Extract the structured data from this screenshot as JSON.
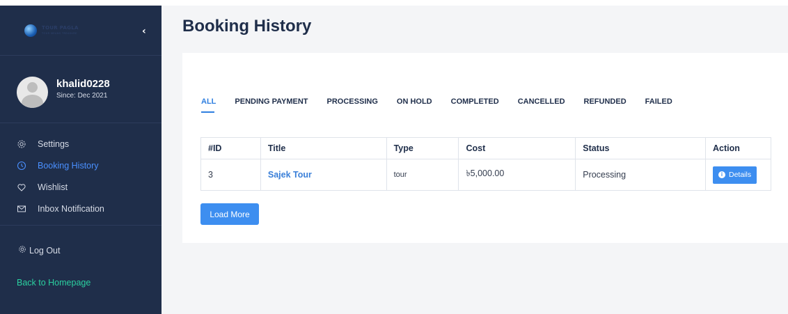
{
  "brand": {
    "logo_name": "TOUR PAGLA",
    "logo_tagline": "TOUR MEANS TREASURE"
  },
  "profile": {
    "username": "khalid0228",
    "since": "Since: Dec 2021"
  },
  "sidebar": {
    "items": [
      {
        "label": "Settings",
        "icon": "gear-icon",
        "active": false
      },
      {
        "label": "Booking History",
        "icon": "clock-icon",
        "active": true
      },
      {
        "label": "Wishlist",
        "icon": "heart-icon",
        "active": false
      },
      {
        "label": "Inbox Notification",
        "icon": "mail-icon",
        "active": false
      }
    ],
    "logout_label": "Log Out",
    "back_home_label": "Back to Homepage"
  },
  "page": {
    "title": "Booking History"
  },
  "tabs": [
    "ALL",
    "PENDING PAYMENT",
    "PROCESSING",
    "ON HOLD",
    "COMPLETED",
    "CANCELLED",
    "REFUNDED",
    "FAILED"
  ],
  "active_tab": "ALL",
  "table": {
    "headers": [
      "#ID",
      "Title",
      "Type",
      "Cost",
      "Status",
      "Action"
    ],
    "rows": [
      {
        "id": "3",
        "title": "Sajek Tour",
        "type": "tour",
        "cost": "৳5,000.00",
        "status": "Processing",
        "action": "Details"
      }
    ]
  },
  "load_more_label": "Load More",
  "colors": {
    "sidebar_bg": "#1f2e4a",
    "accent": "#3d8ef0",
    "active_link": "#4a90ff",
    "back_home": "#2bd0a0"
  }
}
